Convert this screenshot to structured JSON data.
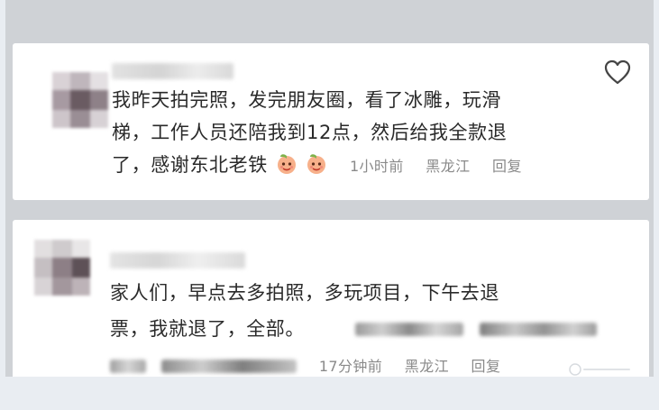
{
  "comments": [
    {
      "text_lines": [
        "我昨天拍完照，发完朋友圈，看了冰雕，玩滑",
        "梯，工作人员还陪我到12点，然后给我全款退",
        "了，感谢东北老铁"
      ],
      "emoji_icons": [
        "peach-face-icon",
        "peach-face-icon"
      ],
      "time": "1小时前",
      "location": "黑龙江",
      "reply_label": "回复",
      "liked": false
    },
    {
      "text_lines": [
        "家人们，早点去多拍照，多玩项目，下午去退",
        "票，我就退了，全部。"
      ],
      "time": "17分钟前",
      "location": "黑龙江",
      "reply_label": "回复"
    }
  ],
  "colors": {
    "page_background": "#e9edf2",
    "frame_background": "#cfd2d6",
    "card_background": "#ffffff",
    "text": "#2a2a2a",
    "meta_text": "#8a8a8a"
  }
}
